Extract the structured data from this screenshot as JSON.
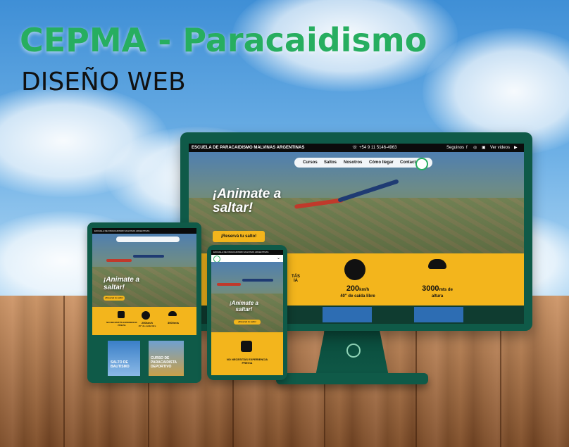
{
  "headline": {
    "title": "CEPMA - Paracaidismo",
    "subtitle": "DISEÑO WEB"
  },
  "colors": {
    "brand_green": "#27ae60",
    "device_green": "#0f5a48",
    "accent_yellow": "#f3b51c",
    "topbar": "#0b0b0b"
  },
  "website": {
    "topbar": {
      "school_name": "ESCUELA DE PARACAIDISMO MALVINAS ARGENTINAS",
      "phone": "+54 9 11 5146-4963",
      "follow_label": "Seguinos",
      "video_label": "Ver videos"
    },
    "nav": [
      "Cursos",
      "Saltos",
      "Nosotros",
      "Cómo llegar",
      "Contactos"
    ],
    "hero": {
      "line1": "¡Animate a",
      "line2": "saltar!",
      "cta": "¡Reservá tu salto!"
    },
    "stats": {
      "left_partial": "TÁS",
      "left_partial2": "IA",
      "speed_value": "200",
      "speed_unit": "km/h",
      "speed_label": "40\" de caída libre",
      "height_value": "3000",
      "height_unit": "mts de",
      "height_label": "altura"
    },
    "tablet_cards": [
      "SALTO DE BAUTISMO",
      "CURSO DE PARACAIDISTA DEPORTIVO"
    ],
    "tablet_stats": {
      "left": "NO NECESITÁS EXPERIENCIA PREVIA",
      "speed": "200km/h",
      "speed_label": "40\" de caída libre",
      "height": "3000mts"
    },
    "phone_stat": "NO NECESITÁS EXPERIENCIA PREVIA"
  },
  "icons": [
    "whatsapp-icon",
    "facebook-icon",
    "instagram-icon",
    "youtube-icon",
    "play-icon",
    "speedometer-icon",
    "parachute-icon",
    "hand-icon"
  ]
}
